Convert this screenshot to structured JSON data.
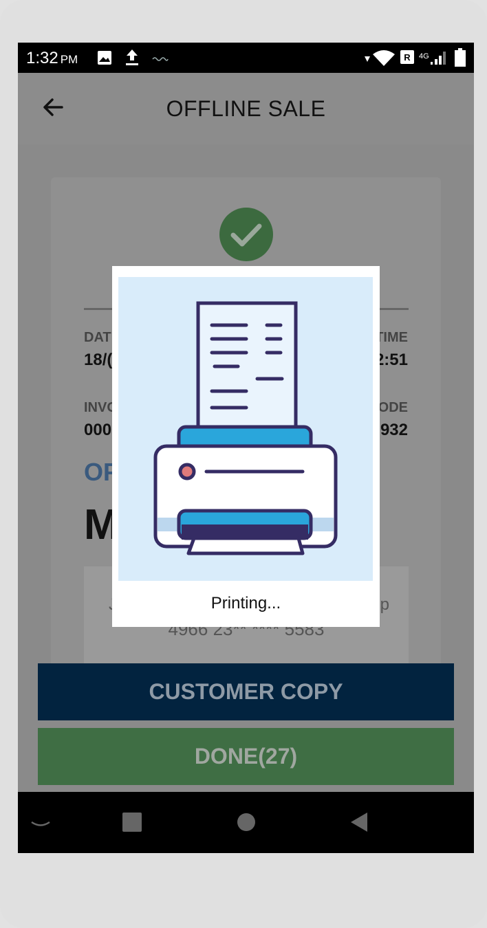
{
  "status_bar": {
    "time": "1:32",
    "ampm": "PM",
    "network_label": "4G",
    "sim_label": "R",
    "icons": [
      "image-icon",
      "upload-icon",
      "signal-squiggle-icon",
      "data-arrow-icon",
      "wifi-icon",
      "roaming-icon",
      "cell-signal-icon",
      "battery-icon"
    ]
  },
  "app_bar": {
    "title": "OFFLINE SALE",
    "back_icon": "arrow-left-icon"
  },
  "receipt": {
    "date_label_visible": "DAT",
    "date_value_visible": "18/(",
    "time_label_visible": "TIME",
    "time_value_visible": "2:51",
    "invoice_label_visible": "INVO",
    "invoice_value_visible": "000",
    "code_label_visible": "ODE",
    "code_value_visible": "932",
    "type_visible": "OF",
    "merchant_visible": "M",
    "card_number": "4966 23** **** 5583",
    "card_side_left": "J",
    "card_side_right": "p"
  },
  "buttons": {
    "customer_copy": "CUSTOMER COPY",
    "done": "DONE(27)"
  },
  "dialog": {
    "message": "Printing..."
  },
  "colors": {
    "overlay": "#8a8a8a",
    "customer_copy_bg": "#02233f",
    "done_bg": "#3f6e44",
    "success_check": "#3c6a3f",
    "dialog_illustration_bg": "#d9ecfa",
    "printer_outline": "#352c64",
    "printer_accent": "#2aa6db"
  }
}
